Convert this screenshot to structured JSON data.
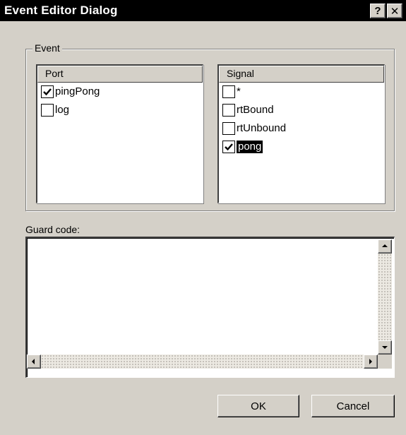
{
  "window": {
    "title": "Event Editor Dialog",
    "help_glyph": "?",
    "close_glyph": "✕"
  },
  "event_group": {
    "label": "Event",
    "port_list": {
      "header": "Port",
      "items": [
        {
          "label": "pingPong",
          "checked": true,
          "selected": false
        },
        {
          "label": "log",
          "checked": false,
          "selected": false
        }
      ]
    },
    "signal_list": {
      "header": "Signal",
      "items": [
        {
          "label": "*",
          "checked": false,
          "selected": false
        },
        {
          "label": "rtBound",
          "checked": false,
          "selected": false
        },
        {
          "label": "rtUnbound",
          "checked": false,
          "selected": false
        },
        {
          "label": "pong",
          "checked": true,
          "selected": true
        }
      ]
    }
  },
  "guard_code": {
    "label": "Guard code:",
    "value": ""
  },
  "buttons": {
    "ok_label": "OK",
    "cancel_label": "Cancel"
  }
}
